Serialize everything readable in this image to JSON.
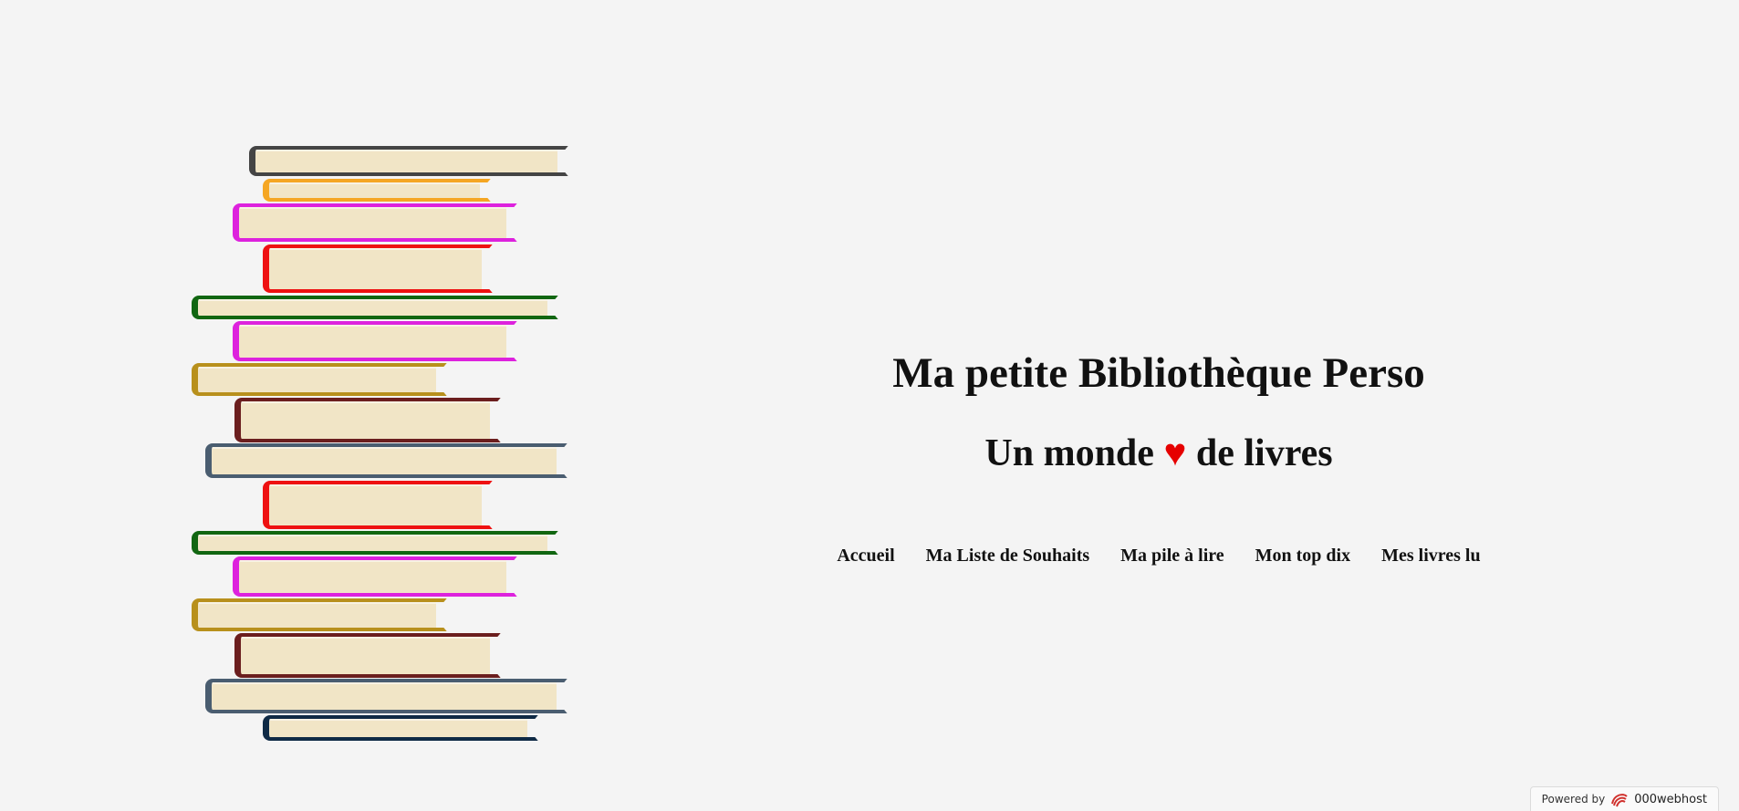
{
  "header": {
    "title": "Ma petite Bibliothèque Perso",
    "subtitle_before": "Un monde ",
    "subtitle_heart": "♥",
    "subtitle_after": " de livres"
  },
  "nav": {
    "items": [
      {
        "label": "Accueil"
      },
      {
        "label": "Ma Liste de Souhaits"
      },
      {
        "label": "Ma pile à lire"
      },
      {
        "label": "Mon top dix"
      },
      {
        "label": "Mes livres lu"
      }
    ]
  },
  "footer": {
    "powered_label": "Powered by",
    "host_name": "000webhost",
    "host_icon": "000webhost-logo-icon"
  },
  "illustration": {
    "name": "book-stack",
    "book_colors": [
      "#444444",
      "#f5a623",
      "#dd22dd",
      "#ee1111",
      "#116611",
      "#dd22dd",
      "#b8901c",
      "#6b1e1e",
      "#4a5d70",
      "#ee1111",
      "#116611",
      "#dd22dd",
      "#b8901c",
      "#6b1e1e",
      "#4a5d70",
      "#0f2a45"
    ],
    "page_color": "#f1e5c6"
  },
  "colors": {
    "background": "#f4f4f4",
    "heart": "#e60000",
    "text": "#111111"
  }
}
